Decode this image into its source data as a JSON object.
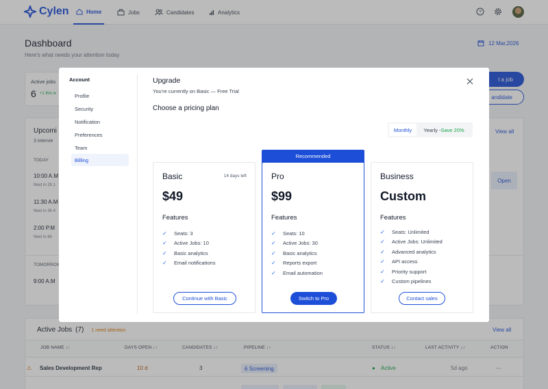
{
  "nav": {
    "brand": "Cylen",
    "items": [
      {
        "label": "Home"
      },
      {
        "label": "Jobs"
      },
      {
        "label": "Candidates"
      },
      {
        "label": "Analytics"
      }
    ]
  },
  "dashboard": {
    "title": "Dashboard",
    "subtitle": "Here's what needs your attention today",
    "date": "12 Mar,2026",
    "active_jobs_label": "Active jobs",
    "active_jobs_value": "6",
    "active_jobs_delta": "+1 this w",
    "post_job_label": "t a job",
    "add_candidate_label": "andidate",
    "upcoming_title": "Upcomi",
    "upcoming_sub": "3 intervie",
    "view_all": "View all",
    "today_label": "TODAY",
    "tomorrow_label": "TOMORROW",
    "interviews": [
      {
        "time": "10:00 A.M",
        "next": "Next in 2h 1"
      },
      {
        "time": "11:30 A.M",
        "next": "Next in 3h 4"
      },
      {
        "time": "2:00 P.M",
        "next": "Next in 6h"
      }
    ],
    "tomorrow_time": "9:00 A.M",
    "open_label": "Open"
  },
  "active_jobs": {
    "title": "Active Jobs",
    "count": "(7)",
    "attention": "1 need attention",
    "view_all": "View all",
    "columns": [
      "JOB NAME",
      "DAYS OPEN",
      "CANDIDATES",
      "PIPELINE",
      "STATUS",
      "LAST ACTIVITY",
      "ACTION"
    ],
    "row": {
      "name": "Sales Development Rep",
      "days": "10 d",
      "candidates": "3",
      "pipeline": "6 Screening",
      "status": "Active",
      "activity": "5d ago",
      "action": "···"
    }
  },
  "modal": {
    "account_label": "Account",
    "menu": [
      "Profile",
      "Security",
      "Notification",
      "Preferences",
      "Team",
      "Billing"
    ],
    "title": "Upgrade",
    "current": "You're currently on Basic — Free Trial",
    "choose": "Choose a pricing plan",
    "toggle_monthly": "Monthly",
    "toggle_yearly": "Yearly - ",
    "toggle_save": "Save 20%",
    "features_label": "Features",
    "recommended": "Recommended",
    "plans": [
      {
        "name": "Basic",
        "badge": "14 days left",
        "price": "$49",
        "features": [
          "Seats: 3",
          "Active Jobs: 10",
          "Basic analytics",
          "Email notifications"
        ],
        "cta": "Continue with Basic"
      },
      {
        "name": "Pro",
        "price": "$99",
        "features": [
          "Seats: 10",
          "Active Jobs: 30",
          "Basic analytics",
          "Reports export",
          "Email automation"
        ],
        "cta": "Switch to Pro"
      },
      {
        "name": "Business",
        "price": "Custom",
        "features": [
          "Seats: Unlimited",
          "Active Jobs: Unlimited",
          "Advanced analytics",
          "API access",
          "Priority support",
          "Custom pipelines"
        ],
        "cta": "Contact sales"
      }
    ]
  },
  "colors": {
    "accent": "#1d4ed8",
    "success": "#16a34a",
    "warning": "#d97706"
  }
}
